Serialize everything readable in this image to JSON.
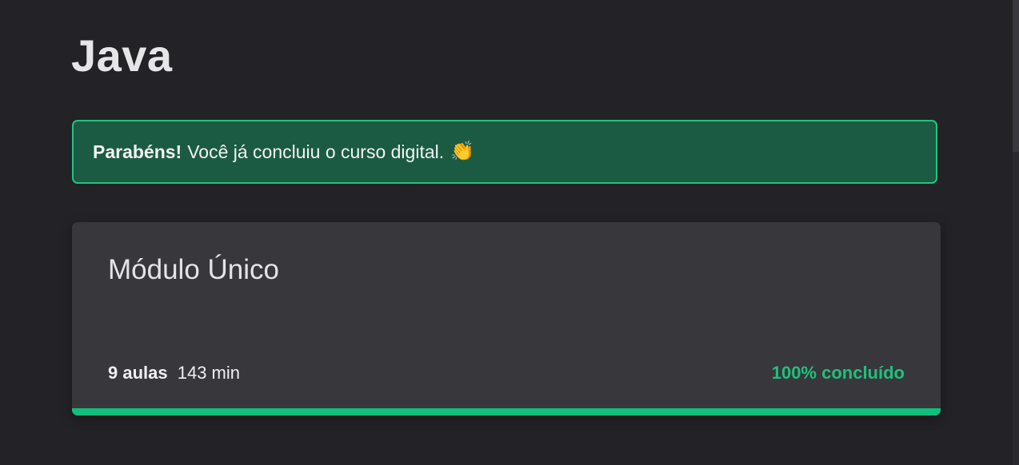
{
  "page": {
    "title": "Java"
  },
  "alert": {
    "strong_text": "Parabéns!",
    "message": "Você já concluiu o curso digital.",
    "icon": "clapping-hands-icon",
    "icon_glyph": "👏"
  },
  "module": {
    "title": "Módulo Único",
    "lessons_label": "9 aulas",
    "duration_label": "143 min",
    "progress_label": "100% concluído",
    "progress_fraction": 1.0
  },
  "colors": {
    "background": "#232227",
    "card": "#38373c",
    "alert_bg": "#1b5b44",
    "alert_border": "#23c47b",
    "accent_green": "#10c07c"
  }
}
